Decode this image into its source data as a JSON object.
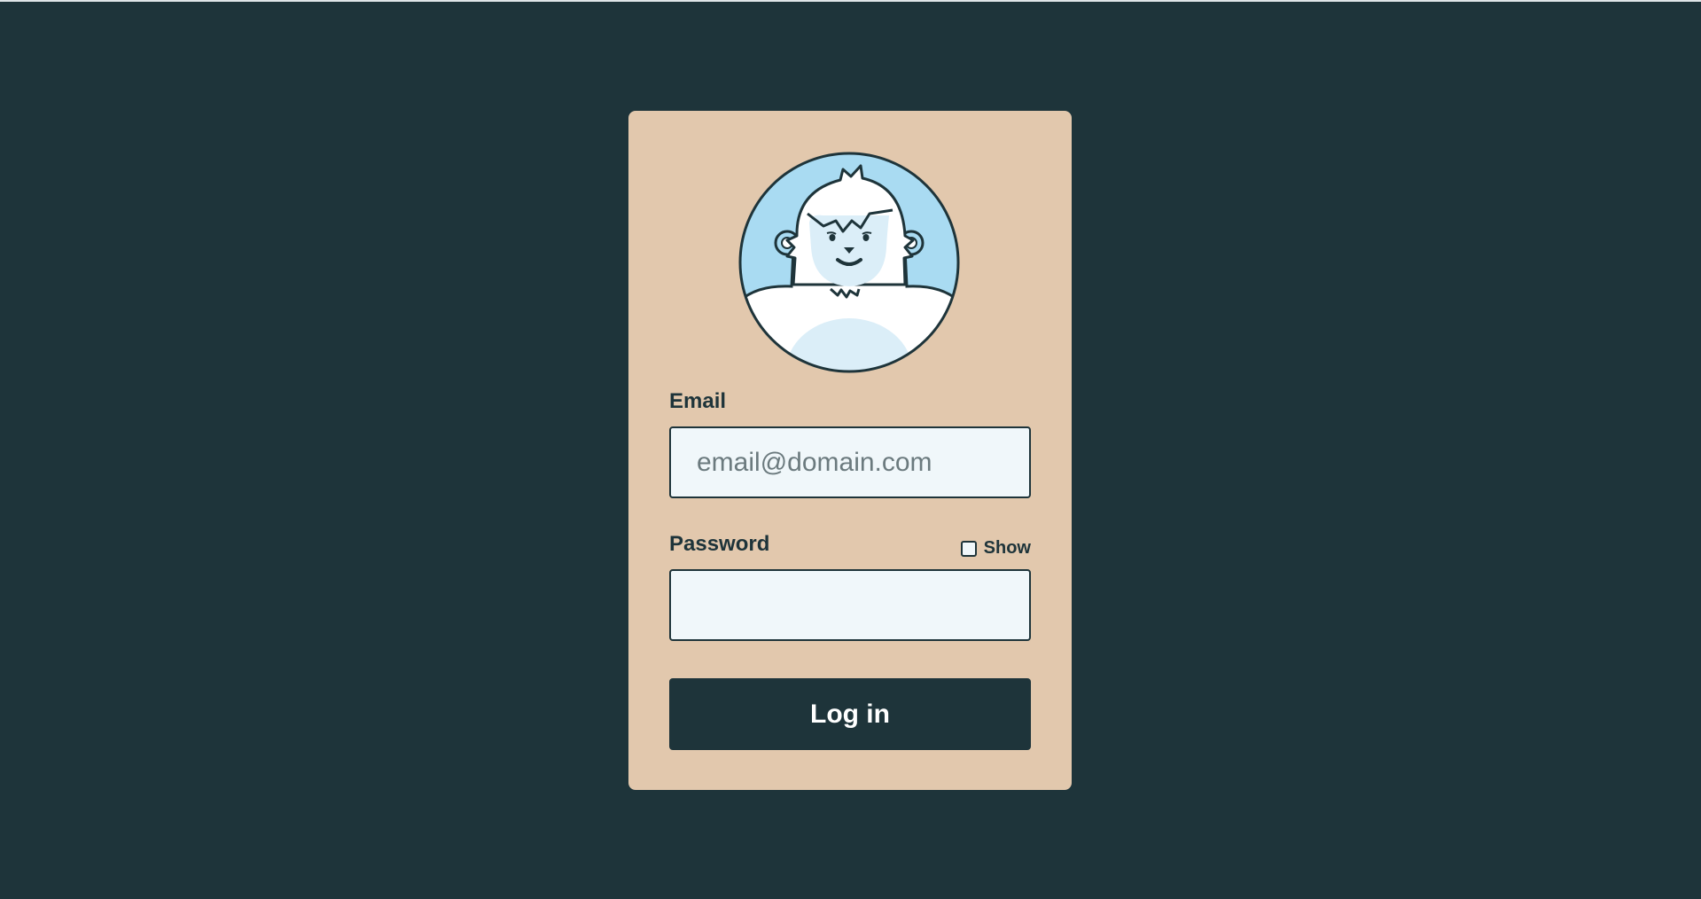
{
  "colors": {
    "background": "#1e343a",
    "card": "#e2c8ad",
    "input_background": "#f0f7fa",
    "button": "#1e343a",
    "avatar_sky": "#a9dbf2"
  },
  "avatar": {
    "icon": "yeti-avatar-icon"
  },
  "email": {
    "label": "Email",
    "placeholder": "email@domain.com",
    "value": ""
  },
  "password": {
    "label": "Password",
    "value": "",
    "show_label": "Show",
    "show_checked": false
  },
  "login_button": {
    "label": "Log in"
  }
}
